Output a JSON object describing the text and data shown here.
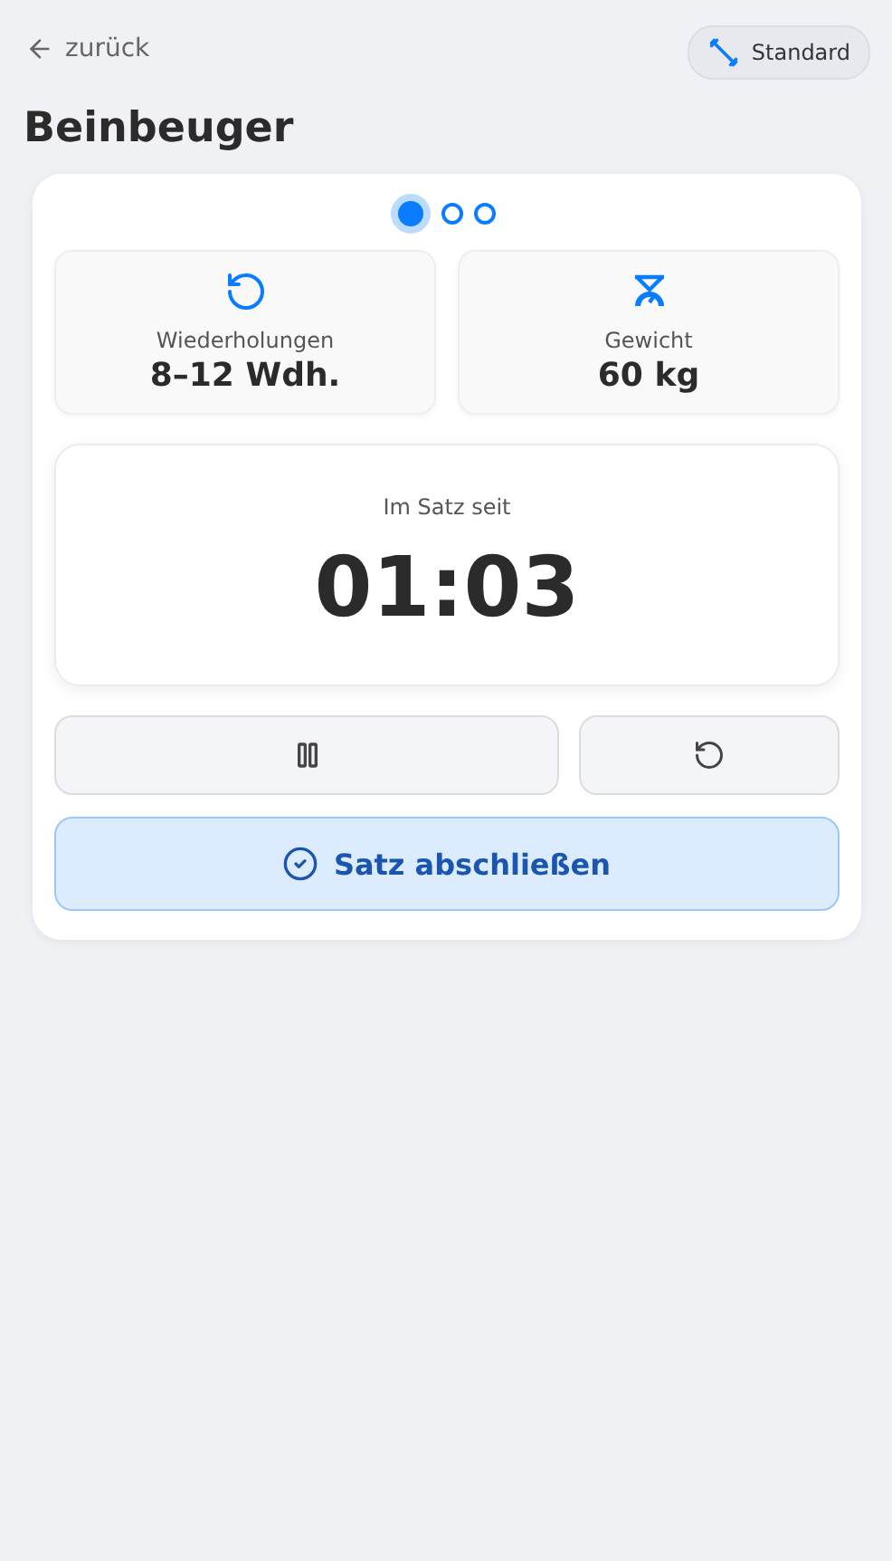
{
  "back": {
    "label": "zurück"
  },
  "mode": {
    "label": "Standard"
  },
  "title": "Beinbeuger",
  "steps": [
    {
      "selected": true
    },
    {
      "selected": false
    },
    {
      "selected": false
    }
  ],
  "stats": [
    {
      "kind": "reps",
      "label": "Wiederholungen",
      "value": "8–12 Wdh."
    },
    {
      "kind": "weight",
      "label": "Gewicht",
      "value": "60 kg"
    }
  ],
  "timer": {
    "label": "Im Satz seit",
    "time": "01:03"
  },
  "controls": [
    {
      "kind": "pause"
    },
    {
      "kind": "reset"
    }
  ],
  "complete": {
    "label": "Satz abschließen"
  }
}
